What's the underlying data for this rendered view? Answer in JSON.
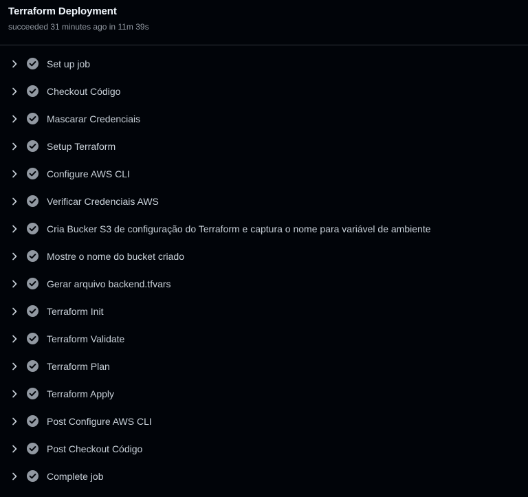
{
  "job": {
    "title": "Terraform Deployment",
    "status": "succeeded 31 minutes ago in 11m 39s"
  },
  "icons": {
    "chevron": "chevron-right-icon",
    "status": "check-circle-icon"
  },
  "colors": {
    "background": "#010409",
    "text": "#c9d1d9",
    "muted": "#9198a1",
    "check_fill": "#9198a1"
  },
  "steps": [
    {
      "label": "Set up job"
    },
    {
      "label": "Checkout Código"
    },
    {
      "label": "Mascarar Credenciais"
    },
    {
      "label": "Setup Terraform"
    },
    {
      "label": "Configure AWS CLI"
    },
    {
      "label": "Verificar Credenciais AWS"
    },
    {
      "label": "Cria Bucker S3 de configuração do Terraform e captura o nome para variável de ambiente"
    },
    {
      "label": "Mostre o nome do bucket criado"
    },
    {
      "label": "Gerar arquivo backend.tfvars"
    },
    {
      "label": "Terraform Init"
    },
    {
      "label": "Terraform Validate"
    },
    {
      "label": "Terraform Plan"
    },
    {
      "label": "Terraform Apply"
    },
    {
      "label": "Post Configure AWS CLI"
    },
    {
      "label": "Post Checkout Código"
    },
    {
      "label": "Complete job"
    }
  ]
}
